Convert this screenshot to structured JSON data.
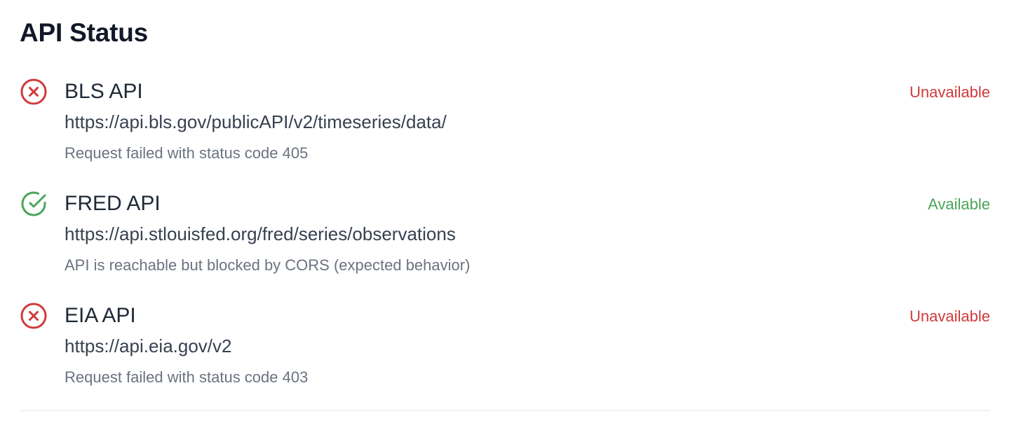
{
  "page": {
    "title": "API Status"
  },
  "colors": {
    "error": "#d03a3a",
    "success": "#4aa55a",
    "text_primary": "#1f2937",
    "text_secondary": "#6b7280"
  },
  "apis": [
    {
      "name": "BLS API",
      "url": "https://api.bls.gov/publicAPI/v2/timeseries/data/",
      "message": "Request failed with status code 405",
      "status": "Unavailable",
      "icon": "x-circle-icon"
    },
    {
      "name": "FRED API",
      "url": "https://api.stlouisfed.org/fred/series/observations",
      "message": "API is reachable but blocked by CORS (expected behavior)",
      "status": "Available",
      "icon": "check-circle-icon"
    },
    {
      "name": "EIA API",
      "url": "https://api.eia.gov/v2",
      "message": "Request failed with status code 403",
      "status": "Unavailable",
      "icon": "x-circle-icon"
    }
  ]
}
